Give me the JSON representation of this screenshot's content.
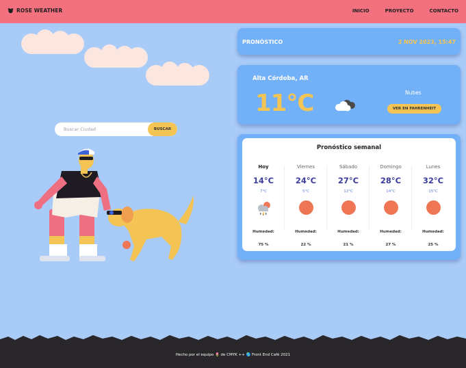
{
  "brand": {
    "name": "ROSE WEATHER",
    "icon": "logo-icon"
  },
  "nav": {
    "items": [
      "INICIO",
      "PROYECTO",
      "CONTACTO"
    ]
  },
  "search": {
    "placeholder": "Buscar Ciudad",
    "button": "BUSCAR"
  },
  "forecast_header": {
    "title": "PRONÓSTICO",
    "datetime": "2 NOV 2023, 15:47"
  },
  "current": {
    "location": "Alta Córdoba, AR",
    "temp": "11°C",
    "description": "Nubes",
    "toggle_button": "VER EN FAHRENHEIT",
    "icon": "cloud-icon"
  },
  "weekly": {
    "title": "Pronóstico semanal",
    "humidity_label": "Humedad:",
    "days": [
      {
        "name": "Hoy",
        "max": "14°C",
        "min": "7°C",
        "icon": "storm-icon",
        "humidity": "75 %"
      },
      {
        "name": "Viernes",
        "max": "24°C",
        "min": "5°C",
        "icon": "sun-icon",
        "humidity": "22 %"
      },
      {
        "name": "Sábado",
        "max": "27°C",
        "min": "12°C",
        "icon": "sun-icon",
        "humidity": "21 %"
      },
      {
        "name": "Domingo",
        "max": "28°C",
        "min": "14°C",
        "icon": "sun-icon",
        "humidity": "27 %"
      },
      {
        "name": "Lunes",
        "max": "32°C",
        "min": "15°C",
        "icon": "sun-icon",
        "humidity": "25 %"
      }
    ]
  },
  "footer": {
    "text": "Hecho por el equipo 🌷 de CMYK ++ 🌎 Front End Café 2021"
  },
  "colors": {
    "topbar": "#f3707f",
    "background": "#a9cbf8",
    "card": "#72b0f8",
    "accent": "#f4c554",
    "sun": "#ee7654",
    "footer": "#2a272b"
  }
}
